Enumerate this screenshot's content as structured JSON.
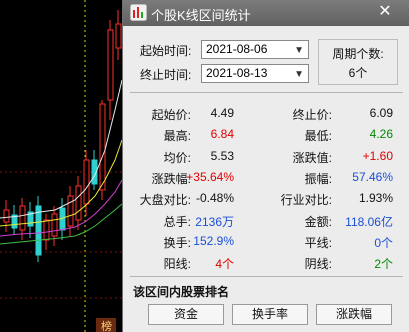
{
  "window": {
    "title": "个股K线区间统计",
    "close_glyph": "✕"
  },
  "range": {
    "start_label": "起始时间:",
    "start_value": "2021-08-06",
    "end_label": "终止时间:",
    "end_value": "2021-08-13",
    "period_count_label": "周期个数:",
    "period_count_value": "6个"
  },
  "stats": [
    {
      "left_key": "起始价:",
      "left_val": "4.49",
      "left_color": "#111111",
      "right_key": "终止价:",
      "right_val": "6.09",
      "right_color": "#111111"
    },
    {
      "left_key": "最高:",
      "left_val": "6.84",
      "left_color": "#e00000",
      "right_key": "最低:",
      "right_val": "4.26",
      "right_color": "#008a00"
    },
    {
      "left_key": "均价:",
      "left_val": "5.53",
      "left_color": "#111111",
      "right_key": "涨跌值:",
      "right_val": "+1.60",
      "right_color": "#e00000"
    },
    {
      "left_key": "涨跌幅:",
      "left_val": "+35.64%",
      "left_color": "#e00000",
      "right_key": "振幅:",
      "right_val": "57.46%",
      "right_color": "#1a4fd6"
    },
    {
      "left_key": "大盘对比:",
      "left_val": "-0.48%",
      "left_color": "#111111",
      "right_key": "行业对比:",
      "right_val": "1.93%",
      "right_color": "#111111"
    },
    {
      "left_key": "总手:",
      "left_val": "2136万",
      "left_color": "#1a4fd6",
      "right_key": "金额:",
      "right_val": "118.06亿",
      "right_color": "#1a4fd6"
    },
    {
      "left_key": "换手:",
      "left_val": "152.9%",
      "left_color": "#1a4fd6",
      "right_key": "平线:",
      "right_val": "0个",
      "right_color": "#1a4fd6"
    },
    {
      "left_key": "阳线:",
      "left_val": "4个",
      "left_color": "#e00000",
      "right_key": "阴线:",
      "right_val": "2个",
      "right_color": "#008a00"
    }
  ],
  "ranking": {
    "section_title": "该区间内股票排名",
    "buttons": [
      "资金",
      "换手率",
      "涨跌幅"
    ]
  },
  "background_chart": {
    "corner_label": "榜"
  }
}
